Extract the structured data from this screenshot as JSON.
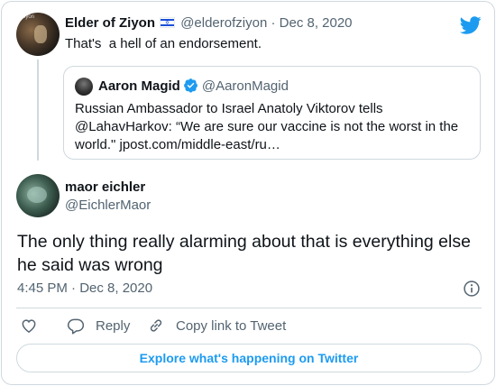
{
  "parent": {
    "name": "Elder of Ziyon",
    "handle": "@elderofziyon",
    "date": "Dec 8, 2020",
    "text": "That's  a hell of an endorsement.",
    "avatar_label": "ziyon"
  },
  "quoted": {
    "name": "Aaron Magid",
    "handle": "@AaronMagid",
    "text": "Russian Ambassador to Israel Anatoly Viktorov tells @LahavHarkov: “We are sure our vaccine is not the worst in the world.\" jpost.com/middle-east/ru…"
  },
  "main": {
    "name": "maor eichler",
    "handle": "@EichlerMaor",
    "text": "The only thing really alarming about that is everything else he said was wrong",
    "timestamp": "4:45 PM · Dec 8, 2020"
  },
  "actions": {
    "reply_label": "Reply",
    "copy_label": "Copy link to Tweet"
  },
  "explore_label": "Explore what's happening on Twitter",
  "icons": {
    "brand": "twitter-bird-icon",
    "verified": "verified-badge-icon",
    "flag": "israel-flag-icon",
    "info": "info-icon",
    "like": "heart-icon",
    "reply": "reply-bubble-icon",
    "copy": "link-icon"
  },
  "colors": {
    "accent": "#1d9bf0",
    "text": "#0f1419",
    "muted": "#536471",
    "border": "#cfd9de"
  }
}
